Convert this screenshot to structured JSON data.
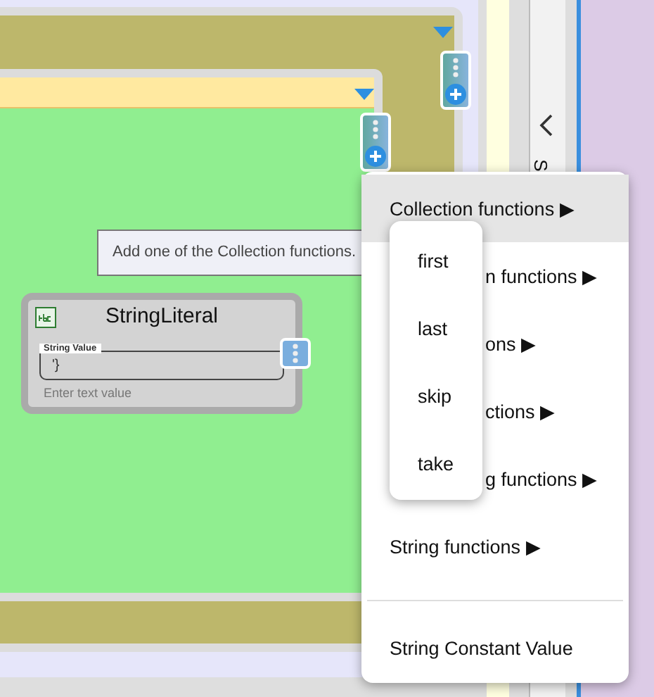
{
  "string_literal_block": {
    "title": "StringLiteral",
    "field": {
      "label": "String Value",
      "value": "'}",
      "hint": "Enter text value"
    }
  },
  "tooltip": "Add one of the Collection functions.",
  "side_panel": {
    "tab_label": "S"
  },
  "context_menu": {
    "items": [
      {
        "label": "Collection functions ▶",
        "selected": true
      },
      {
        "label": "n functions ▶",
        "selected": false
      },
      {
        "label": "ons ▶",
        "selected": false
      },
      {
        "label": "ctions ▶",
        "selected": false
      },
      {
        "label": "g functions ▶",
        "selected": false
      },
      {
        "label": "String functions ▶",
        "selected": false
      }
    ],
    "footer_item": "String Constant Value"
  },
  "submenu": {
    "items": [
      "first",
      "last",
      "skip",
      "take"
    ]
  }
}
